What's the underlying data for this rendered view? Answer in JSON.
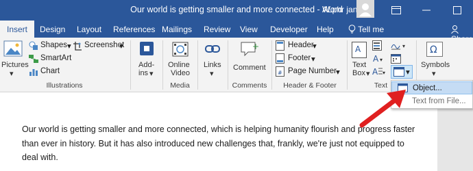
{
  "titlebar": {
    "document_title": "Our world is getting smaller and more connected  -  Word",
    "user_name": "ALphr jan"
  },
  "tabs": [
    "Insert",
    "Design",
    "Layout",
    "References",
    "Mailings",
    "Review",
    "View",
    "Developer",
    "Help"
  ],
  "tell_me": "Tell me",
  "share": "Share",
  "ribbon": {
    "pictures": "Pictures",
    "shapes": "Shapes",
    "smartart": "SmartArt",
    "chart": "Chart",
    "screenshot": "Screenshot",
    "illustrations": "Illustrations",
    "addins_line1": "Add-",
    "addins_line2": "ins",
    "online_video_line1": "Online",
    "online_video_line2": "Video",
    "media": "Media",
    "links": "Links",
    "comment": "Comment",
    "comments": "Comments",
    "header": "Header",
    "footer": "Footer",
    "page_number": "Page Number",
    "header_footer": "Header & Footer",
    "text_box_line1": "Text",
    "text_box_line2": "Box",
    "text": "Text",
    "symbols": "Symbols"
  },
  "dropdown": {
    "items": [
      {
        "label": "Object...",
        "highlighted": true
      },
      {
        "label": "Text from File...",
        "highlighted": false
      }
    ]
  },
  "document": {
    "paragraph": "Our world is getting smaller and more connected, which is helping humanity flourish and progress faster than ever in history. But it has also introduced new challenges that, frankly, we're just not equipped to deal with."
  },
  "colors": {
    "title_bar": "#2b579a",
    "ribbon": "#f3f3f3",
    "annotation_arrow": "#e02020"
  }
}
